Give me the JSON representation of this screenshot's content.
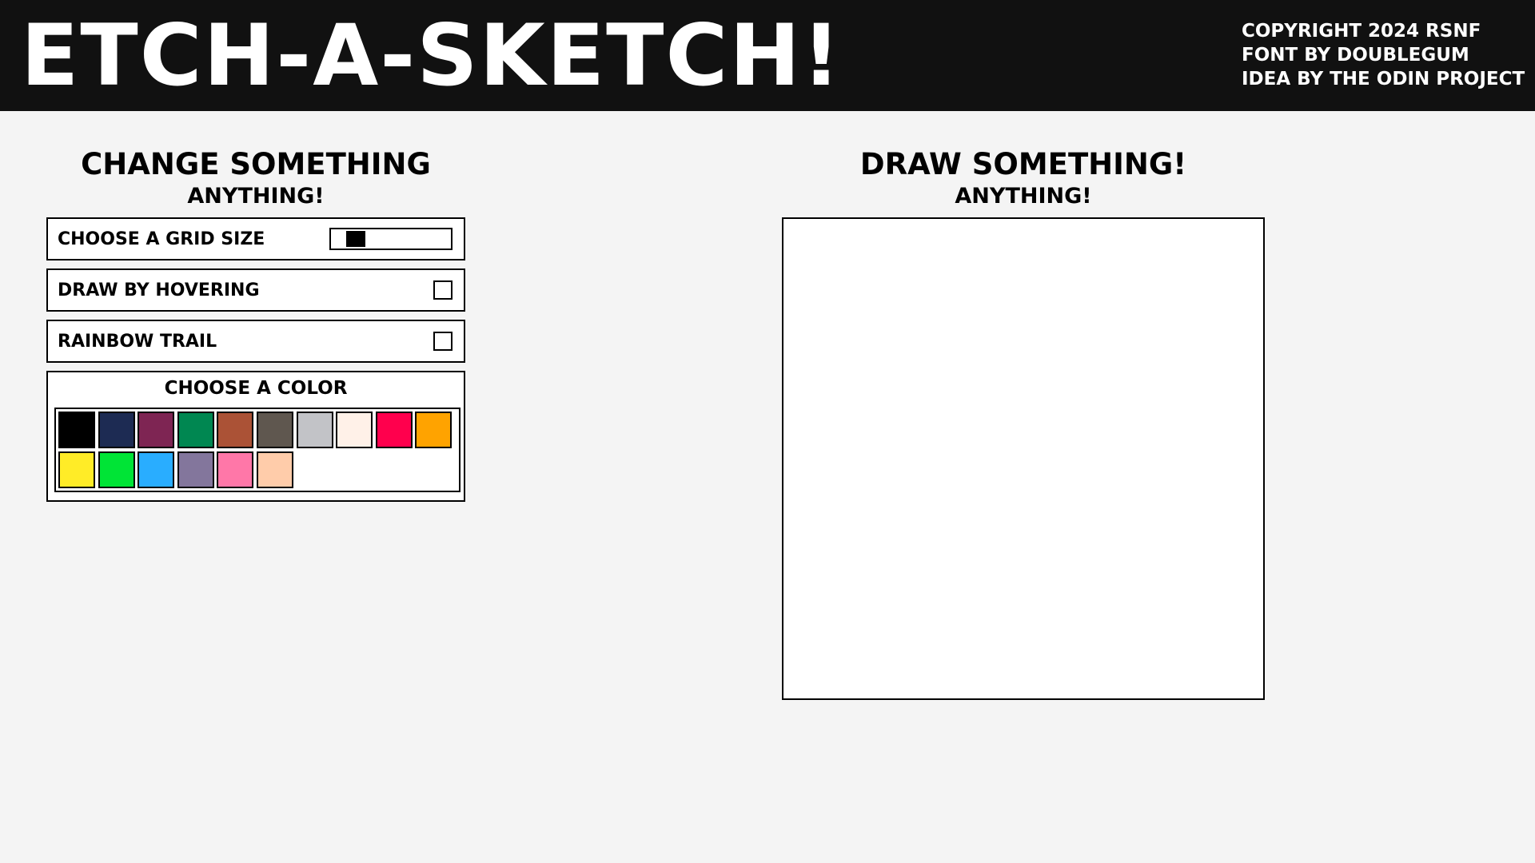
{
  "header": {
    "title": "Etch-a-sketch!",
    "credits": [
      "Copyright 2024 rsnf",
      "Font by Doublegum",
      "Idea by the odin project"
    ]
  },
  "controls": {
    "title": "Change something",
    "subtitle": "Anything!",
    "grid_size": {
      "label": "Choose a grid size",
      "level": 0.15
    },
    "hover": {
      "label": "Draw by hovering",
      "checked": false
    },
    "rainbow": {
      "label": "Rainbow trail",
      "checked": false
    },
    "colors": {
      "label": "Choose a color",
      "swatches": [
        "#000000",
        "#1d2b53",
        "#7e2553",
        "#008751",
        "#ab5236",
        "#5f574f",
        "#c2c3c7",
        "#fff1e8",
        "#ff004d",
        "#ffa300",
        "#ffec27",
        "#00e436",
        "#29adff",
        "#83769c",
        "#ff77a8",
        "#ffccaa"
      ]
    }
  },
  "canvas_section": {
    "title": "Draw something!",
    "subtitle": "Anything!"
  }
}
